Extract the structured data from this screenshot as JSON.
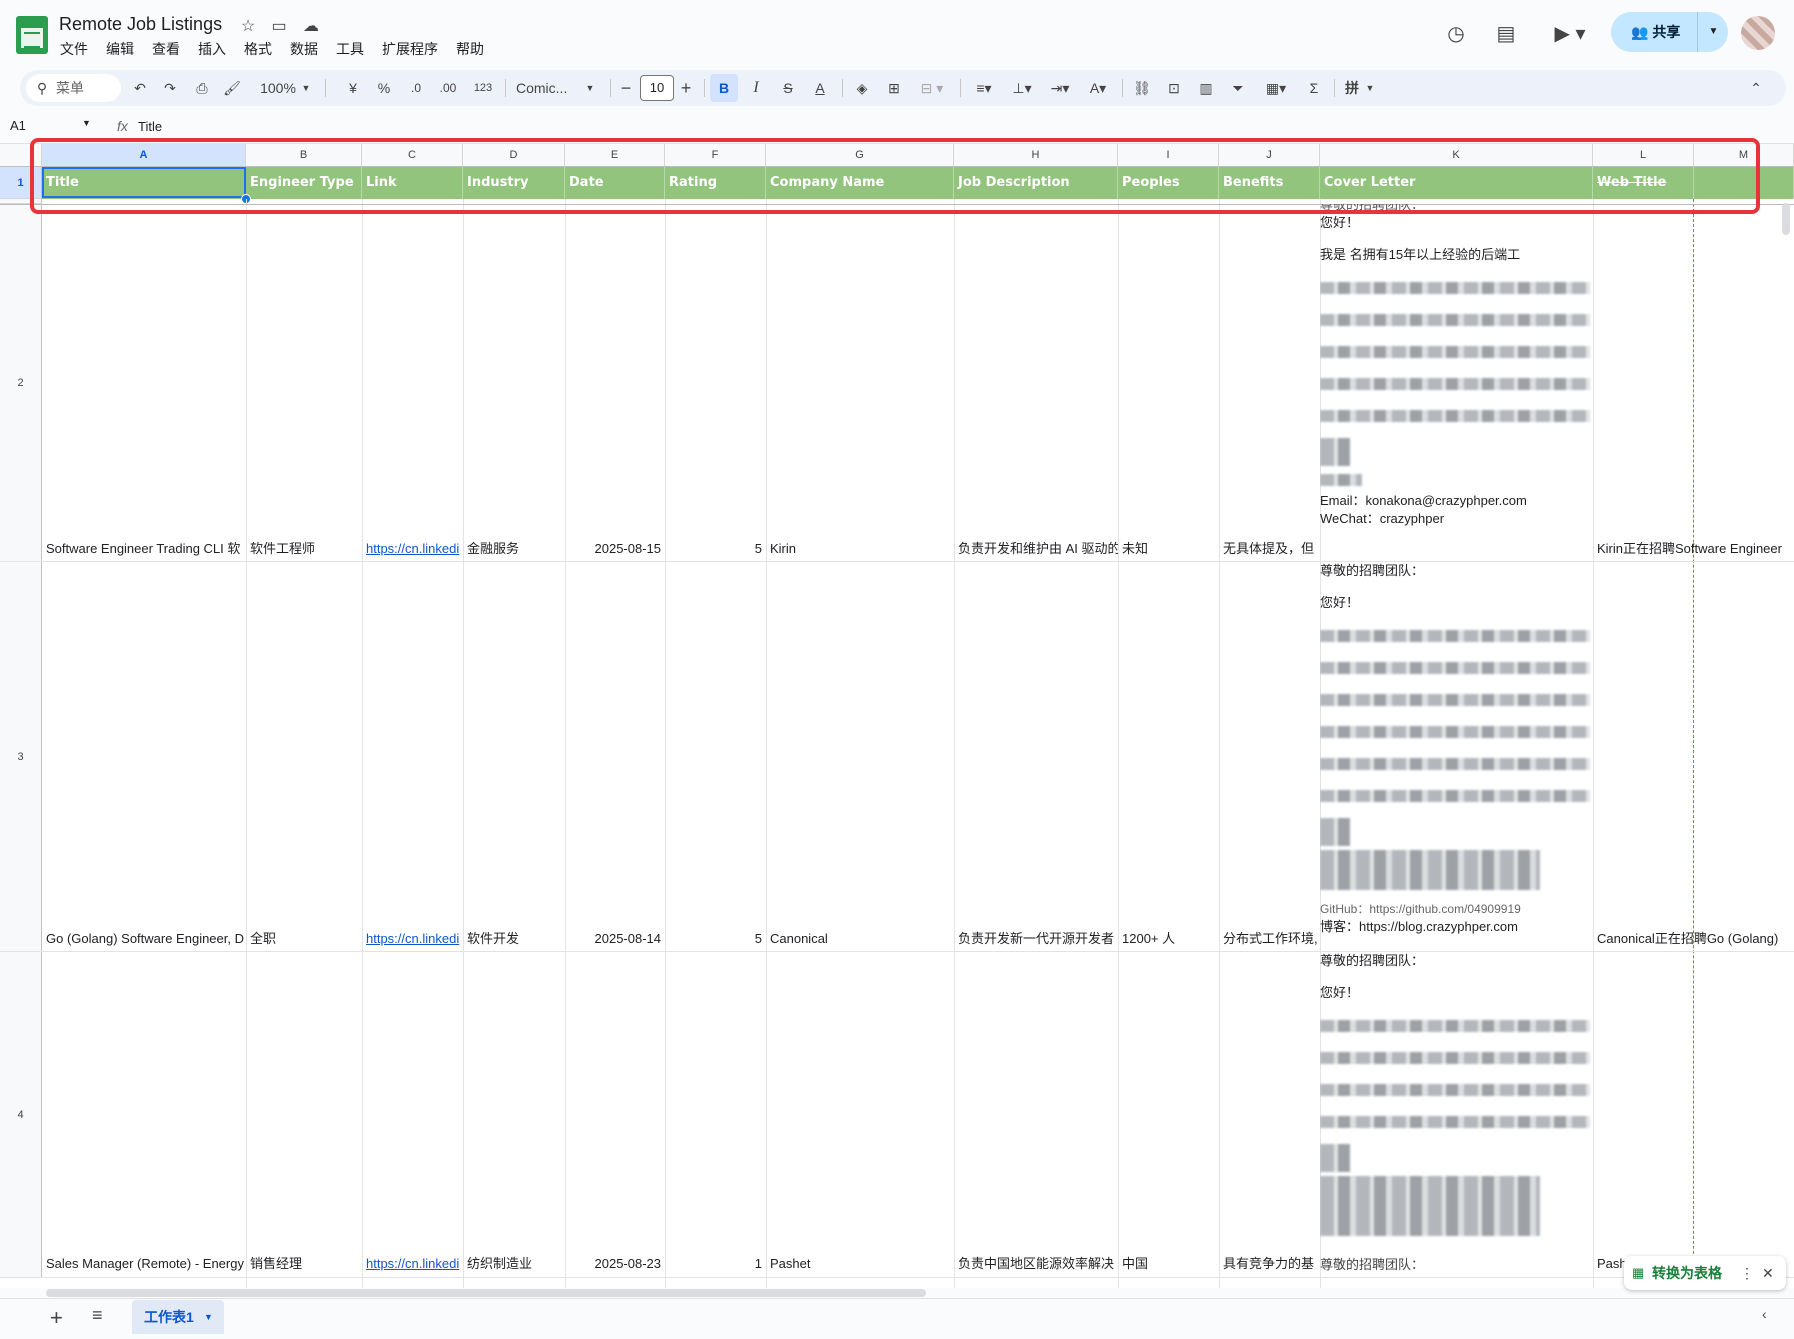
{
  "app": {
    "doc_title": "Remote Job Listings",
    "menu": [
      "文件",
      "编辑",
      "查看",
      "插入",
      "格式",
      "数据",
      "工具",
      "扩展程序",
      "帮助"
    ],
    "share_label": "共享"
  },
  "toolbar": {
    "search_placeholder": "菜单",
    "zoom": "100%",
    "currency": "¥",
    "percent": "%",
    "dec_decrease": ".0",
    "dec_increase": ".00",
    "number_format": "123",
    "font": "Comic...",
    "font_size": "10",
    "bold": "B",
    "italic": "I",
    "strike": "S",
    "text_color": "A",
    "pinyin": "拼"
  },
  "formula_bar": {
    "cell_ref": "A1",
    "fx": "fx",
    "content": "Title"
  },
  "columns": [
    "A",
    "B",
    "C",
    "D",
    "E",
    "F",
    "G",
    "H",
    "I",
    "J",
    "K",
    "L",
    "M"
  ],
  "header_row": {
    "row_number": "1",
    "cells": [
      "Title",
      "Engineer Type",
      "Link",
      "Industry",
      "Date",
      "Rating",
      "Company Name",
      "Job Description",
      "Peoples",
      "Benefits",
      "Cover Letter",
      "Web Title",
      ""
    ]
  },
  "rows": [
    {
      "row_number": "2",
      "cells": [
        "Software Engineer Trading CLI 软",
        "软件工程师",
        "https://cn.linkedi",
        "金融服务",
        "2025-08-15",
        "5",
        "Kirin",
        "负责开发和维护由 AI 驱动的",
        "未知",
        "无具体提及，但",
        "",
        "Kirin正在招聘Software Engineer",
        ""
      ],
      "cover_letter": [
        "尊敬的招聘团队：",
        "您好！",
        "我是 名拥有15年以上经验的后端工",
        "Email：konakona@crazyphper.com",
        "WeChat：crazyphper"
      ]
    },
    {
      "row_number": "3",
      "cells": [
        "Go (Golang) Software Engineer, D",
        "全职",
        "https://cn.linkedi",
        "软件开发",
        "2025-08-14",
        "5",
        "Canonical",
        "负责开发新一代开源开发者",
        "1200+ 人",
        "分布式工作环境,",
        "",
        "Canonical正在招聘Go (Golang)",
        ""
      ],
      "cover_letter": [
        "尊敬的招聘团队：",
        "您好！",
        "GitHub：https://github.com/04909919",
        "博客：https://blog.crazyphper.com"
      ]
    },
    {
      "row_number": "4",
      "cells": [
        "Sales Manager (Remote) - Energy",
        "销售经理",
        "https://cn.linkedi",
        "纺织制造业",
        "2025-08-23",
        "1",
        "Pashet",
        "负责中国地区能源效率解决",
        "中国",
        "具有竞争力的基",
        "",
        "Pash",
        ""
      ],
      "cover_letter": [
        "尊敬的招聘团队：",
        "您好！",
        "尊敬的招聘团队："
      ]
    }
  ],
  "sheet_tab": "工作表1",
  "convert_table": "转换为表格"
}
